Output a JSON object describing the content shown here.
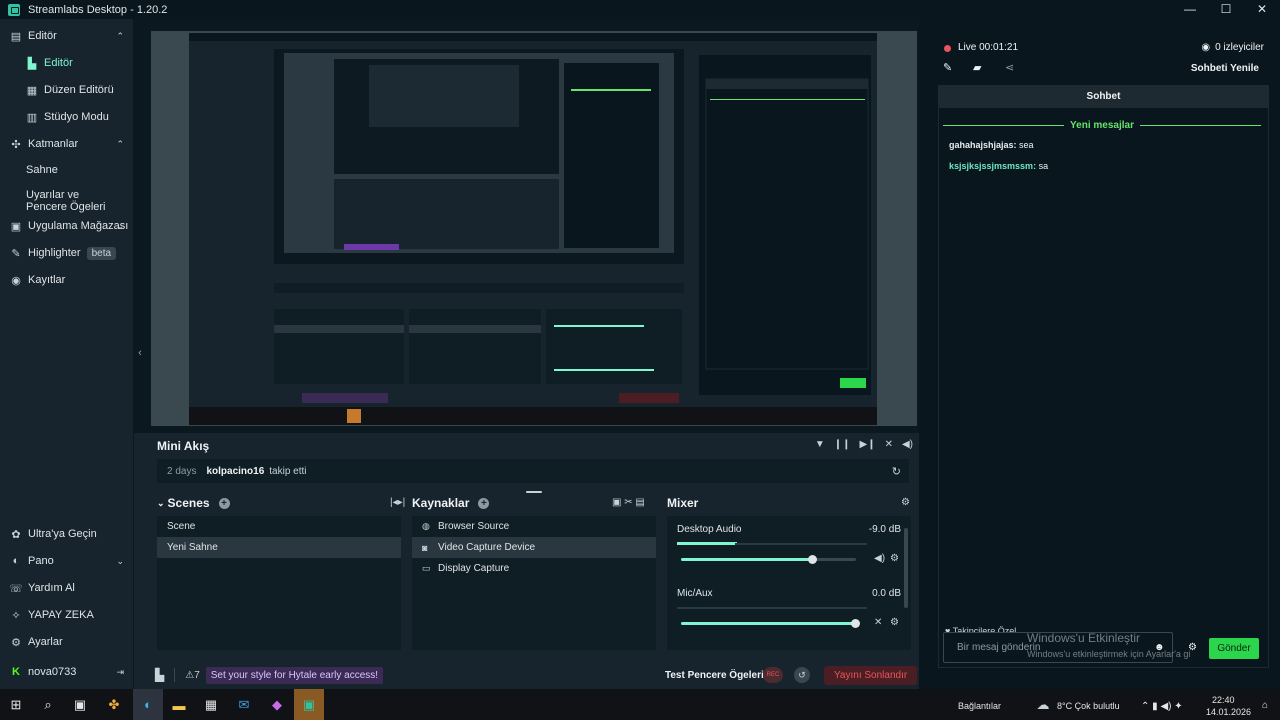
{
  "window": {
    "title": "Streamlabs Desktop - 1.20.2",
    "controls": [
      "—",
      "☐",
      "✕"
    ]
  },
  "nav": {
    "editor": "Editör",
    "editor_sub": "Editör",
    "layout_editor": "Düzen Editörü",
    "studio_mode": "Stüdyo Modu",
    "layers": "Katmanlar",
    "scene": "Sahne",
    "apps_windows": "Uyarılar ve Pencere Ögeleri",
    "app_store": "Uygulama Mağazası",
    "highlighter": "Highlighter",
    "beta": "beta",
    "recordings": "Kayıtlar",
    "ultra": "Ultra'ya Geçin",
    "dashboard": "Pano",
    "help": "Yardım Al",
    "ai": "YAPAY ZEKA",
    "settings": "Ayarlar",
    "user": "nova0733"
  },
  "mini": {
    "title": "Mini Akış",
    "days": "2 days",
    "user": "kolpacino16",
    "action": "takip etti"
  },
  "scenes": {
    "title": "Scenes",
    "items": [
      "Scene",
      "Yeni Sahne"
    ]
  },
  "sources": {
    "title": "Kaynaklar",
    "items": [
      "Browser Source",
      "Video Capture Device",
      "Display Capture"
    ]
  },
  "mixer": {
    "title": "Mixer",
    "channels": [
      {
        "name": "Desktop Audio",
        "db": "-9.0 dB",
        "level": 0.75
      },
      {
        "name": "Mic/Aux",
        "db": "0.0 dB",
        "level": 1.0
      }
    ]
  },
  "statusbar": {
    "promo": "Set your style for Hytale early access!",
    "test": "Test Pencere Ögeleri",
    "rec": "REC",
    "end": "Yayını Sonlandır"
  },
  "chat": {
    "live": "Live 00:01:21",
    "viewers": "0 izleyiciler",
    "refresh": "Sohbeti Yenile",
    "header": "Sohbet",
    "new_messages": "Yeni mesajlar",
    "messages": [
      {
        "user": "gahahajshjajas",
        "text": "sea"
      },
      {
        "user": "ksjsjksjssjmsmssm",
        "text": "sa"
      }
    ],
    "subs_only": "Takipçilere Özel",
    "placeholder": "Bir mesaj gönderin",
    "send": "Gönder",
    "watermark_title": "Windows'u Etkinleştir",
    "watermark_sub": "Windows'u etkinleştirmek için Ayarlar'a gi"
  },
  "taskbar": {
    "connections": "Bağlantılar",
    "weather": "8°C  Çok bulutlu",
    "time": "22:40",
    "date": "14.01.2026"
  }
}
